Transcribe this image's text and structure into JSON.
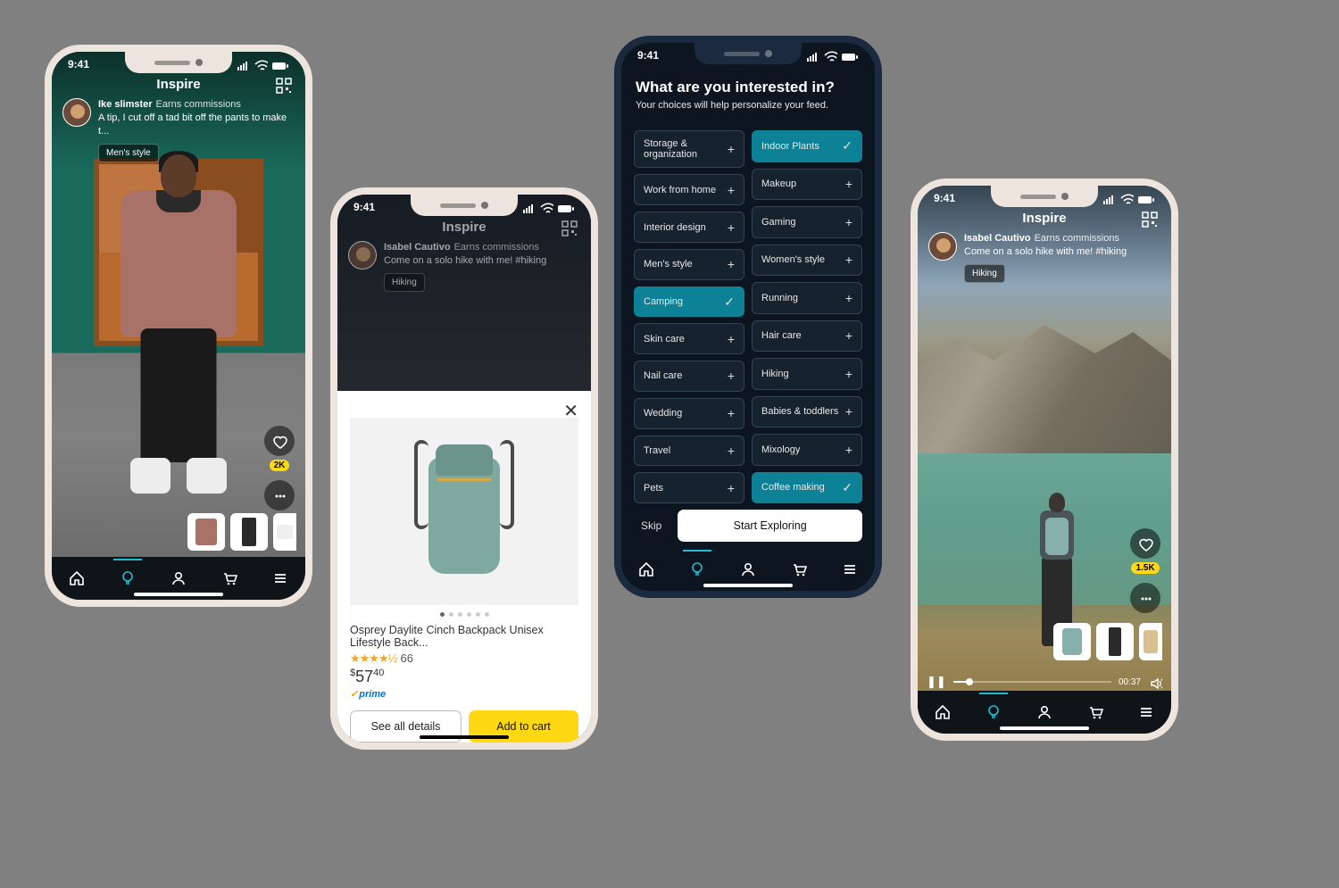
{
  "status": {
    "time": "9:41"
  },
  "phone1": {
    "title": "Inspire",
    "author": {
      "name": "Ike slimster",
      "earns": "Earns commissions",
      "caption": "A tip, I cut off a tad bit off the pants to make t..."
    },
    "tag": "Men's style",
    "likes": "2K"
  },
  "phone2": {
    "title": "Inspire",
    "author": {
      "name": "Isabel Cautivo",
      "earns": "Earns commissions",
      "caption": "Come on a solo hike with me! #hiking"
    },
    "tag": "Hiking",
    "product": {
      "title": "Osprey Daylite Cinch Backpack Unisex Lifestyle Back...",
      "rating_count": "66",
      "price_dollar": "$",
      "price_main": "57",
      "price_cents": "40",
      "prime": "prime",
      "see_all": "See all details",
      "add": "Add to cart"
    }
  },
  "phone3": {
    "heading": "What are you interested in?",
    "sub": "Your choices will help personalize your feed.",
    "left": [
      {
        "label": "Storage & organization",
        "sel": false,
        "tall": true
      },
      {
        "label": "Work from home",
        "sel": false
      },
      {
        "label": "Interior design",
        "sel": false
      },
      {
        "label": "Men's style",
        "sel": false
      },
      {
        "label": "Camping",
        "sel": true
      },
      {
        "label": "Skin care",
        "sel": false
      },
      {
        "label": "Nail care",
        "sel": false
      },
      {
        "label": "Wedding",
        "sel": false
      },
      {
        "label": "Travel",
        "sel": false
      },
      {
        "label": "Pets",
        "sel": false
      }
    ],
    "right": [
      {
        "label": "Indoor Plants",
        "sel": true
      },
      {
        "label": "Makeup",
        "sel": false
      },
      {
        "label": "Gaming",
        "sel": false
      },
      {
        "label": "Women's style",
        "sel": false
      },
      {
        "label": "Running",
        "sel": false
      },
      {
        "label": "Hair care",
        "sel": false
      },
      {
        "label": "Hiking",
        "sel": false
      },
      {
        "label": "Babies & toddlers",
        "sel": false
      },
      {
        "label": "Mixology",
        "sel": false
      },
      {
        "label": "Coffee making",
        "sel": true
      }
    ],
    "skip": "Skip",
    "explore": "Start Exploring"
  },
  "phone4": {
    "title": "Inspire",
    "author": {
      "name": "Isabel Cautivo",
      "earns": "Earns commissions",
      "caption": "Come on a solo hike with me! #hiking"
    },
    "tag": "Hiking",
    "likes": "1.5K",
    "playtime": "00:37"
  },
  "nav_icons": [
    "home",
    "inspire",
    "profile",
    "cart",
    "menu"
  ]
}
